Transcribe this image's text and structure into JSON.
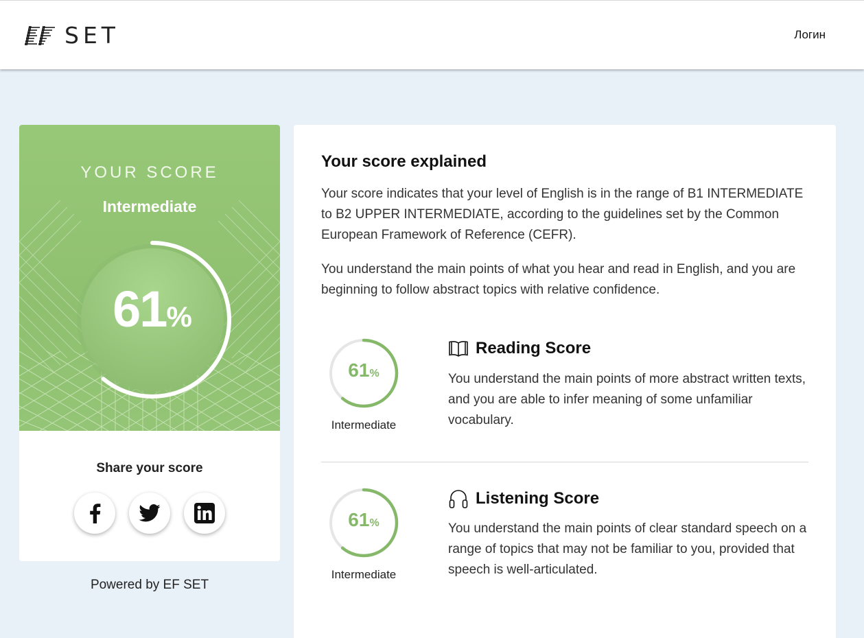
{
  "header": {
    "logo_mark": "EF",
    "logo_text": "SET",
    "login_label": "Логин"
  },
  "score_card": {
    "heading": "YOUR SCORE",
    "level": "Intermediate",
    "score_value": "61",
    "score_unit": "%",
    "score_fraction": 0.61,
    "share_title": "Share your score",
    "social": [
      {
        "name": "facebook",
        "icon": "facebook-icon"
      },
      {
        "name": "twitter",
        "icon": "twitter-icon"
      },
      {
        "name": "linkedin",
        "icon": "linkedin-icon"
      }
    ]
  },
  "powered_by": "Powered by EF SET",
  "explanation": {
    "title": "Your score explained",
    "paragraph1": "Your score indicates that your level of English is in the range of B1 INTERMEDIATE to B2 UPPER INTERMEDIATE, according to the guidelines set by the Common European Framework of Reference (CEFR).",
    "paragraph2": "You understand the main points of what you hear and read in English, and you are beginning to follow abstract topics with relative confidence.",
    "reading": {
      "icon": "book-icon",
      "title": "Reading Score",
      "score_value": "61",
      "score_unit": "%",
      "score_fraction": 0.61,
      "level": "Intermediate",
      "description": "You understand the main points of more abstract written texts, and you are able to infer meaning of some unfamiliar vocabulary."
    },
    "listening": {
      "icon": "headphones-icon",
      "title": "Listening Score",
      "score_value": "61",
      "score_unit": "%",
      "score_fraction": 0.61,
      "level": "Intermediate",
      "description": "You understand the main points of clear standard speech on a range of topics that may not be familiar to you, provided that speech is well-articulated."
    }
  },
  "colors": {
    "accent_green": "#86b86a",
    "panel_green": "#94c576",
    "page_bg": "#e8f0f8"
  }
}
